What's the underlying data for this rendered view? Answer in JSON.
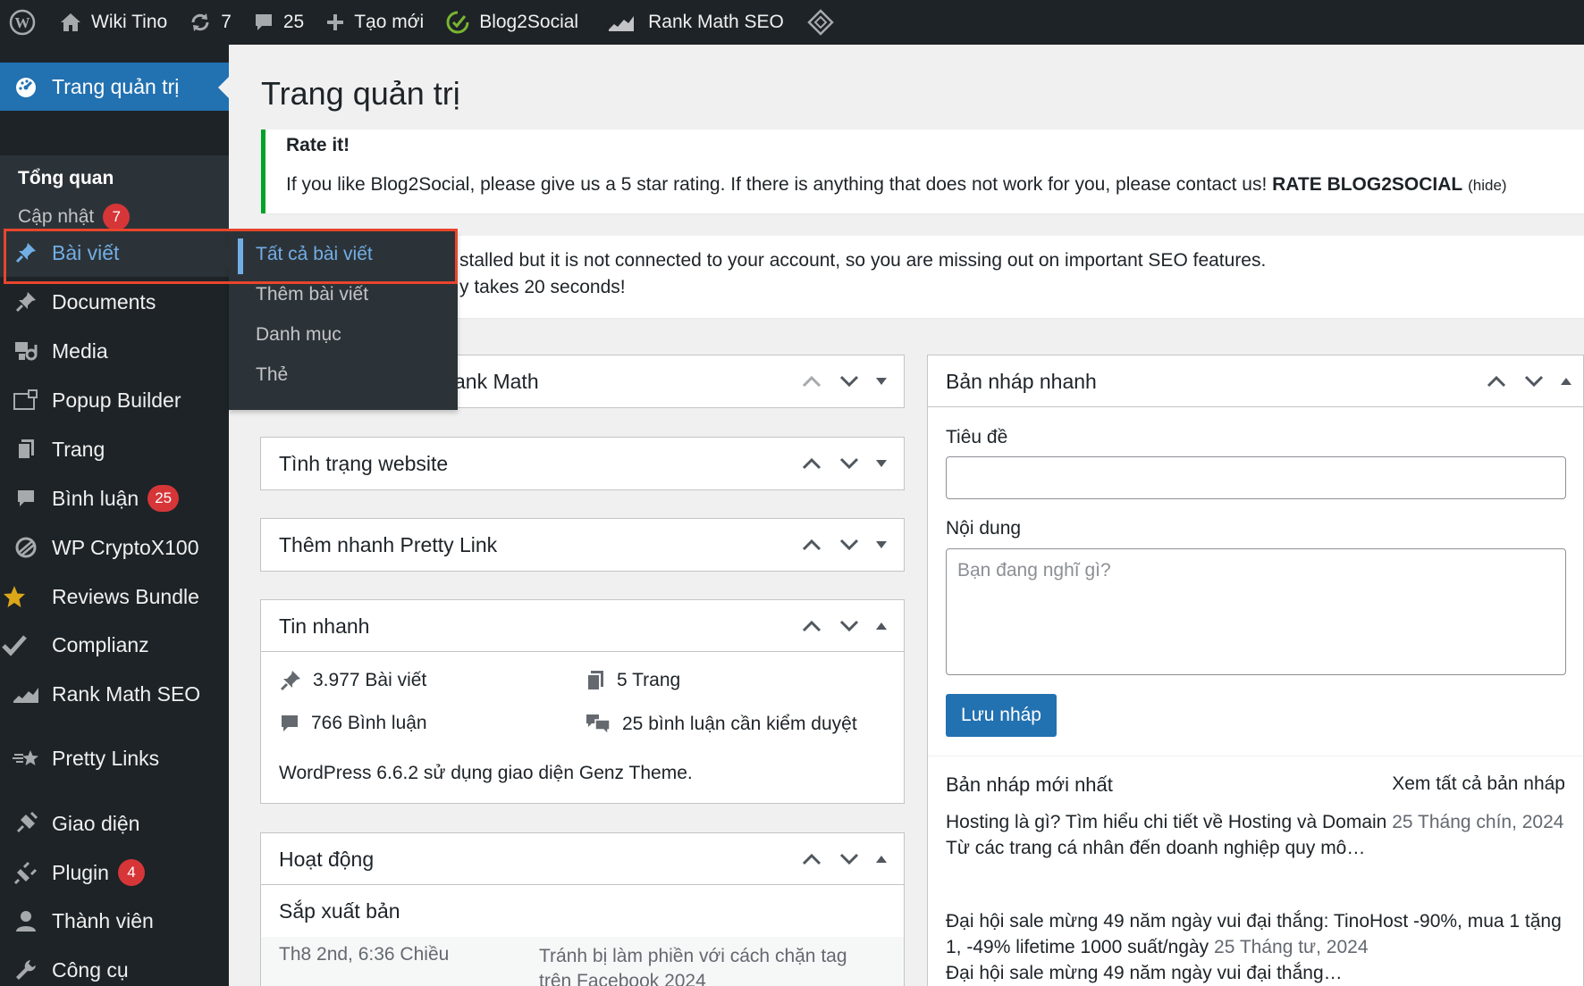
{
  "adminbar": {
    "site_name": "Wiki Tino",
    "updates_count": "7",
    "comments_count": "25",
    "new_label": "Tạo mới",
    "blog2social_label": "Blog2Social",
    "rankmath_label": "Rank Math SEO"
  },
  "sidebar": {
    "dashboard_label": "Trang quản trị",
    "overview_label": "Tổng quan",
    "updates_label": "Cập nhật",
    "updates_badge": "7",
    "items": [
      {
        "label": "Bài viết"
      },
      {
        "label": "Documents"
      },
      {
        "label": "Media"
      },
      {
        "label": "Popup Builder"
      },
      {
        "label": "Trang"
      },
      {
        "label": "Bình luận",
        "badge": "25"
      },
      {
        "label": "WP CryptoX100"
      },
      {
        "label": "Reviews Bundle"
      },
      {
        "label": "Complianz"
      },
      {
        "label": "Rank Math SEO"
      },
      {
        "label": "Pretty Links"
      },
      {
        "label": "Giao diện"
      },
      {
        "label": "Plugin",
        "badge": "4"
      },
      {
        "label": "Thành viên"
      },
      {
        "label": "Công cụ"
      }
    ],
    "flyout": [
      "Tất cả bài viết",
      "Thêm bài viết",
      "Danh mục",
      "Thẻ"
    ]
  },
  "page": {
    "title": "Trang quản trị"
  },
  "notices": {
    "rate_title": "Rate it!",
    "rate_message": "If you like Blog2Social, please give us a 5 star rating. If there is anything that does not work for you, please contact us!",
    "rate_cta": "RATE BLOG2SOCIAL",
    "rate_hide": "(hide)",
    "rankmath_line1": "stalled but it is not connected to your account, so you are missing out on important SEO features.",
    "rankmath_line2": "y takes 20 seconds!"
  },
  "widgets": {
    "rankmath_title_partial": "ank Math",
    "site_health_title": "Tình trạng website",
    "pretty_link_title": "Thêm nhanh Pretty Link",
    "glance_title": "Tin nhanh",
    "glance": {
      "posts": "3.977 Bài viết",
      "pages": "5 Trang",
      "comments": "766 Bình luận",
      "moderation": "25 bình luận cần kiểm duyệt",
      "wp_info": "WordPress 6.6.2 sử dụng giao diện Genz Theme."
    },
    "activity_title": "Hoạt động",
    "activity": {
      "scheduled_label": "Sắp xuất bản",
      "date": "Th8 2nd, 6:36 Chiều",
      "post_line1": "Tránh bị làm phiền với cách chặn tag",
      "post_line2": "trên Facebook 2024"
    },
    "quick_draft": {
      "title": "Bản nháp nhanh",
      "title_label": "Tiêu đề",
      "title_value": "",
      "content_label": "Nội dung",
      "content_placeholder": "Bạn đang nghĩ gì?",
      "save_label": "Lưu nháp",
      "recent_drafts_label": "Bản nháp mới nhất",
      "view_all_label": "Xem tất cả bản nháp",
      "drafts": [
        {
          "title": "Hosting là gì? Tìm hiểu chi tiết về Hosting và Domain",
          "date": "25 Tháng chín, 2024",
          "excerpt": "Từ các trang cá nhân đến doanh nghiệp quy mô…"
        },
        {
          "title": "Đại hội sale mừng 49 năm ngày vui đại thắng: TinoHost -90%, mua 1 tặng 1, -49% lifetime 1000 suất/ngày",
          "date": "25 Tháng tư, 2024",
          "excerpt": "Đại hội sale mừng 49 năm ngày vui đại thắng…"
        }
      ]
    }
  },
  "colors": {
    "adminbar_bg": "#1d2327",
    "sidebar_bg": "#1d2327",
    "accent": "#2271b1",
    "badge": "#d63638",
    "notice_success": "#00a32a",
    "highlight_annotation": "#e8452c"
  }
}
